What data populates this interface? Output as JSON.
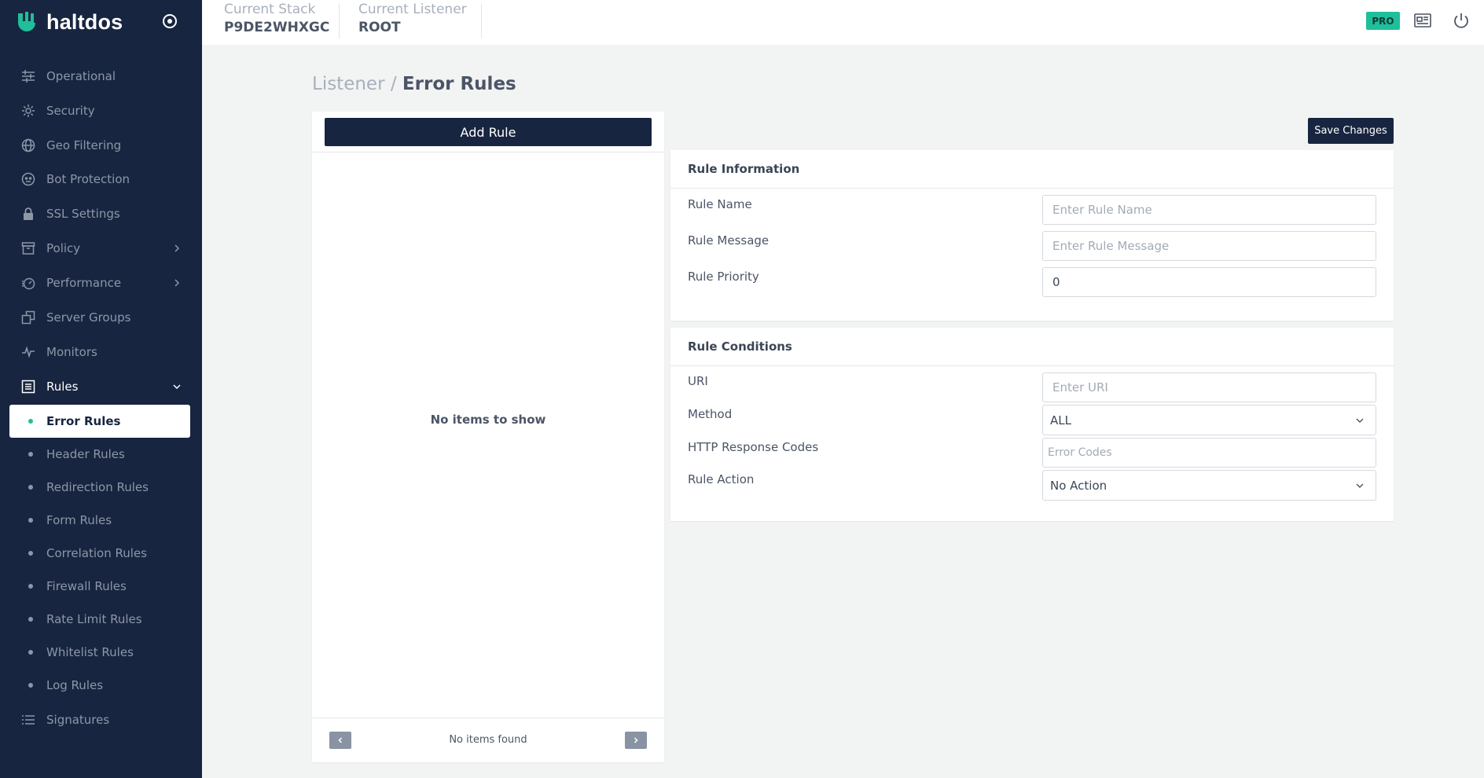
{
  "app": {
    "brand": "haltdos",
    "accent": "#1fbf9b",
    "sidebar_bg": "#182540"
  },
  "topbar": {
    "stack_label": "Current Stack",
    "stack_value": "P9DE2WHXGC",
    "listener_label": "Current Listener",
    "listener_value": "ROOT",
    "badge": "PRO",
    "icons": [
      "news-icon",
      "power-icon"
    ]
  },
  "sidebar": {
    "items": [
      {
        "label": "Operational",
        "icon": "sliders-icon"
      },
      {
        "label": "Security",
        "icon": "gear-icon"
      },
      {
        "label": "Geo Filtering",
        "icon": "globe-icon"
      },
      {
        "label": "Bot Protection",
        "icon": "robot-icon"
      },
      {
        "label": "SSL Settings",
        "icon": "lock-icon"
      },
      {
        "label": "Policy",
        "icon": "archive-icon",
        "expandable": true
      },
      {
        "label": "Performance",
        "icon": "speedometer-icon",
        "expandable": true
      },
      {
        "label": "Server Groups",
        "icon": "copy-icon"
      },
      {
        "label": "Monitors",
        "icon": "pulse-icon"
      },
      {
        "label": "Rules",
        "icon": "list-icon",
        "expandable": true,
        "open": true
      },
      {
        "label": "Signatures",
        "icon": "list-lines-icon"
      }
    ],
    "rules_children": [
      {
        "label": "Error Rules",
        "active": true
      },
      {
        "label": "Header Rules"
      },
      {
        "label": "Redirection Rules"
      },
      {
        "label": "Form Rules"
      },
      {
        "label": "Correlation Rules"
      },
      {
        "label": "Firewall Rules"
      },
      {
        "label": "Rate Limit Rules"
      },
      {
        "label": "Whitelist Rules"
      },
      {
        "label": "Log Rules"
      }
    ]
  },
  "page": {
    "breadcrumb_parent": "Listener",
    "breadcrumb_sep": "/",
    "breadcrumb_current": "Error Rules"
  },
  "rule_list": {
    "add_label": "Add Rule",
    "empty_message": "No items to show",
    "footer_text": "No items found"
  },
  "save_label": "Save Changes",
  "rule_info": {
    "title": "Rule Information",
    "name_label": "Rule Name",
    "name_placeholder": "Enter Rule Name",
    "name_value": "",
    "message_label": "Rule Message",
    "message_placeholder": "Enter Rule Message",
    "message_value": "",
    "priority_label": "Rule Priority",
    "priority_value": "0"
  },
  "rule_conditions": {
    "title": "Rule Conditions",
    "uri_label": "URI",
    "uri_placeholder": "Enter URI",
    "uri_value": "",
    "method_label": "Method",
    "method_value": "ALL",
    "codes_label": "HTTP Response Codes",
    "codes_placeholder": "Error Codes",
    "codes_value": "",
    "action_label": "Rule Action",
    "action_value": "No Action"
  }
}
